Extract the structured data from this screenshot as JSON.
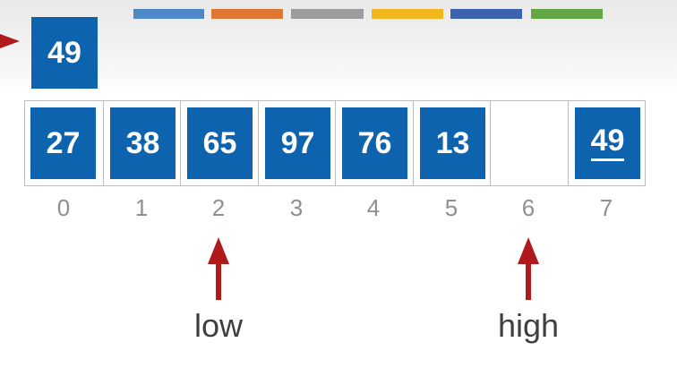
{
  "legend_bars": [
    {
      "color": "#4f88c7"
    },
    {
      "color": "#e07631"
    },
    {
      "color": "#9c9c9c"
    },
    {
      "color": "#f2b71f"
    },
    {
      "color": "#3d62ae"
    },
    {
      "color": "#63a744"
    }
  ],
  "pivot": {
    "value": "49"
  },
  "array": {
    "cells": [
      {
        "index": "0",
        "value": "27",
        "filled": true
      },
      {
        "index": "1",
        "value": "38",
        "filled": true
      },
      {
        "index": "2",
        "value": "65",
        "filled": true
      },
      {
        "index": "3",
        "value": "97",
        "filled": true
      },
      {
        "index": "4",
        "value": "76",
        "filled": true
      },
      {
        "index": "5",
        "value": "13",
        "filled": true
      },
      {
        "index": "6",
        "value": "",
        "filled": false
      },
      {
        "index": "7",
        "value": "49",
        "filled": true,
        "underlined": true
      }
    ]
  },
  "pointers": {
    "low": {
      "label": "low",
      "index": 2
    },
    "high": {
      "label": "high",
      "index": 6
    }
  },
  "colors": {
    "tile": "#0d63ad",
    "arrow": "#b01a1a",
    "index_text": "#8f8f8f",
    "label_text": "#3f3f3f"
  }
}
